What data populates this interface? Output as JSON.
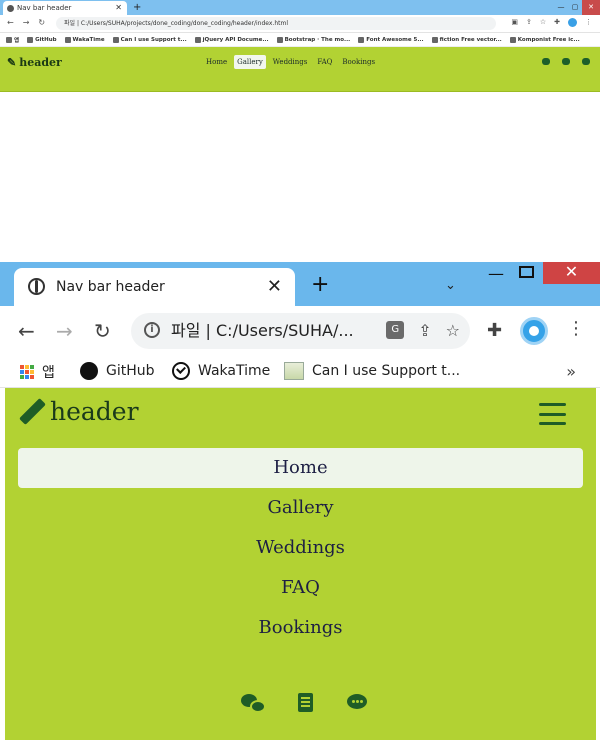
{
  "small": {
    "tab_title": "Nav bar header",
    "url": "파일 | C:/Users/SUHA/projects/done_coding/done_coding/header/index.html",
    "bookmarks": [
      "앱",
      "GitHub",
      "WakaTime",
      "Can I use Support t...",
      "jQuery API Docume...",
      "Bootstrap · The mo...",
      "Font Awesome 5...",
      "fiction Free vector...",
      "Komponist Free ic..."
    ],
    "brand": "header",
    "nav": [
      "Home",
      "Gallery",
      "Weddings",
      "FAQ",
      "Bookings"
    ],
    "active": "Gallery"
  },
  "big": {
    "tab_title": "Nav bar header",
    "url": "파일  |  C:/Users/SUHA/...",
    "bookmarks": {
      "apps": "앱",
      "github": "GitHub",
      "wakatime": "WakaTime",
      "caniuse": "Can I use Support t..."
    },
    "brand": "header",
    "nav": {
      "home": "Home",
      "gallery": "Gallery",
      "weddings": "Weddings",
      "faq": "FAQ",
      "bookings": "Bookings"
    },
    "active": "Home"
  },
  "colors": {
    "navbar_bg": "#b2d233",
    "icon_green": "#1f5d26",
    "link_text": "#1d1f44",
    "active_bg": "#eef5ea",
    "tab_strip": "#6ab7ec"
  },
  "icons": [
    "globe-icon",
    "pencil-icon",
    "hamburger-icon",
    "comments-icon",
    "list-icon",
    "comment-dots-icon"
  ]
}
